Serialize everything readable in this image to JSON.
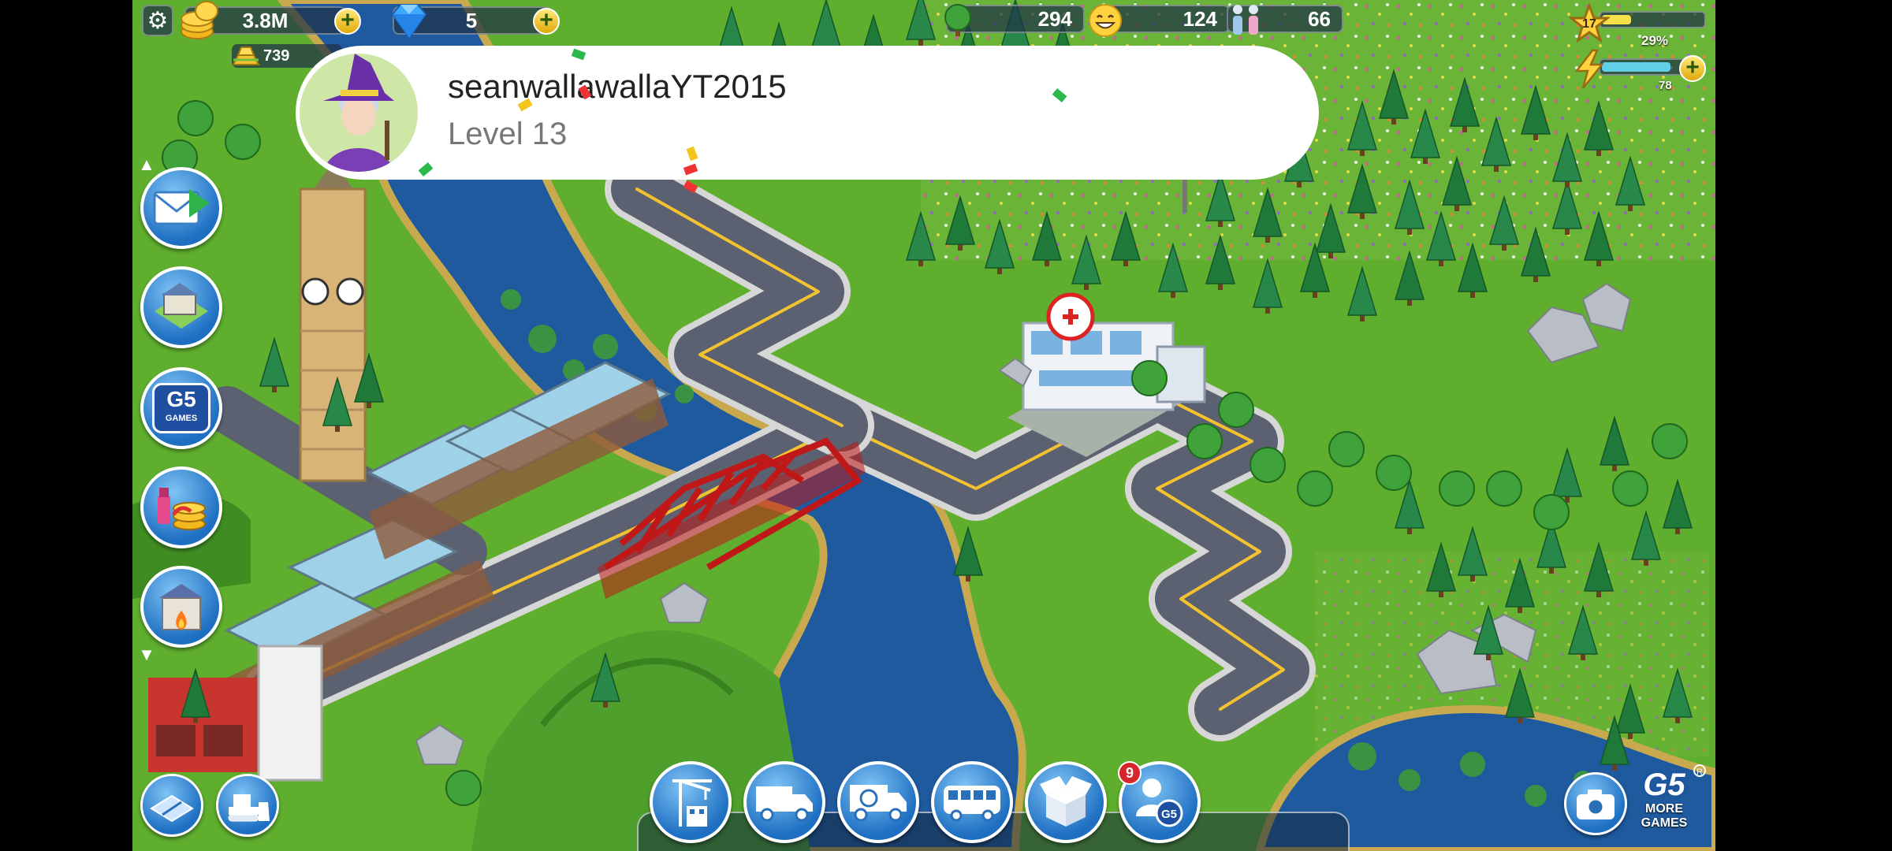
{
  "hud": {
    "coins": "3.8M",
    "gems": "5",
    "gold_bars": "739",
    "trees": "294",
    "happiness": "124",
    "population": "66",
    "player_level": "17",
    "xp_percent": "29%",
    "energy": "78",
    "xp_fraction": 0.29,
    "energy_fraction": 0.78
  },
  "player_banner": {
    "name": "seanwallawallaYT2015",
    "level": "Level 13"
  },
  "side_menu": [
    {
      "name": "mail-button",
      "icon": "envelope-icon"
    },
    {
      "name": "city-buildings-button",
      "icon": "house-icon"
    },
    {
      "name": "g5-games-button",
      "icon": "g5-games-icon",
      "label": "GAMES"
    },
    {
      "name": "shop-button",
      "icon": "cosmetics-coins-icon"
    },
    {
      "name": "fire-station-button",
      "icon": "fire-station-icon"
    }
  ],
  "bottom_bar": [
    {
      "name": "construction-button",
      "icon": "crane-icon"
    },
    {
      "name": "delivery-truck-button",
      "icon": "truck-icon"
    },
    {
      "name": "recycle-truck-button",
      "icon": "recycle-truck-icon"
    },
    {
      "name": "bus-button",
      "icon": "bus-icon"
    },
    {
      "name": "storage-box-button",
      "icon": "box-icon"
    },
    {
      "name": "friends-button",
      "icon": "friends-g5-icon",
      "badge": "9"
    }
  ],
  "bottom_left": [
    {
      "name": "road-tool-button",
      "icon": "road-icon"
    },
    {
      "name": "bulldozer-button",
      "icon": "bulldozer-icon"
    }
  ],
  "bottom_right": {
    "camera_icon": "camera-icon",
    "more_games_label_top": "G5",
    "more_games_label": "MORE",
    "more_games_label2": "GAMES"
  },
  "colors": {
    "grass": "#5fae2e",
    "water": "#1f5a9e",
    "road": "#5b6170",
    "road_line": "#f2c230",
    "bridge": "#d32222",
    "button_blue": "#1e6fc2"
  }
}
